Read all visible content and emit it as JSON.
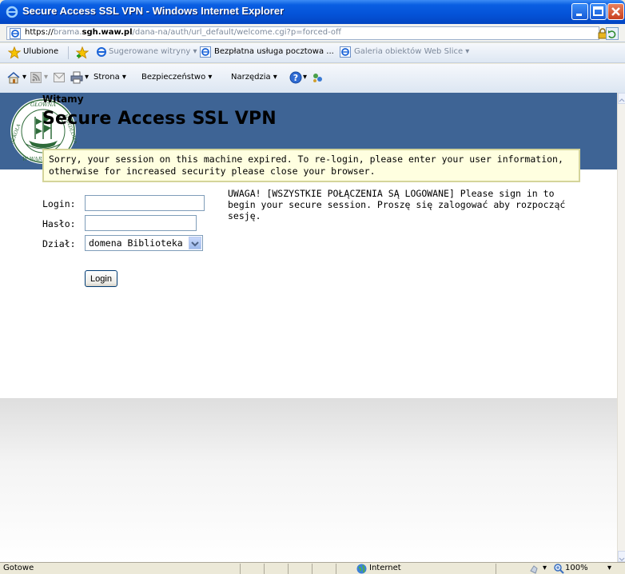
{
  "window": {
    "title": "Secure Access SSL VPN - Windows Internet Explorer"
  },
  "address": {
    "scheme": "https://",
    "host_dim_prefix": "brama.",
    "host": "sgh.waw.pl",
    "path": "/dana-na/auth/url_default/welcome.cgi?p=forced-off"
  },
  "favorites": {
    "label": "Ulubione",
    "suggested": "Sugerowane witryny ▾",
    "mail": "Bezpłatna usługa pocztowa ...",
    "gallery": "Galeria obiektów Web Slice ▾"
  },
  "commandbar": {
    "page": "Strona ▾",
    "security": "Bezpieczeństwo ▾",
    "tools": "Narzędzia ▾"
  },
  "page": {
    "welcome": "Witamy",
    "title": "Secure Access SSL VPN",
    "message": "Sorry, your session on this machine expired. To re-login, please enter your user information, otherwise for increased security please close your browser.",
    "login_label": "Login:",
    "password_label": "Hasło:",
    "department_label": "Dział:",
    "login_value": "",
    "password_value": "",
    "department_selected": "domena Biblioteka",
    "notice": "UWAGA! [WSZYSTKIE POŁĄCZENIA SĄ LOGOWANE] Please sign in to begin your secure session. Proszę się zalogować aby rozpocząć sesję.",
    "login_button": "Login"
  },
  "status": {
    "left": "Gotowe",
    "zone": "Internet",
    "zoom": "100%"
  },
  "colors": {
    "header_bg": "#3e6495",
    "message_bg": "#ffffe0",
    "message_border": "#d4d49a",
    "titlebar": "#0453d8"
  }
}
